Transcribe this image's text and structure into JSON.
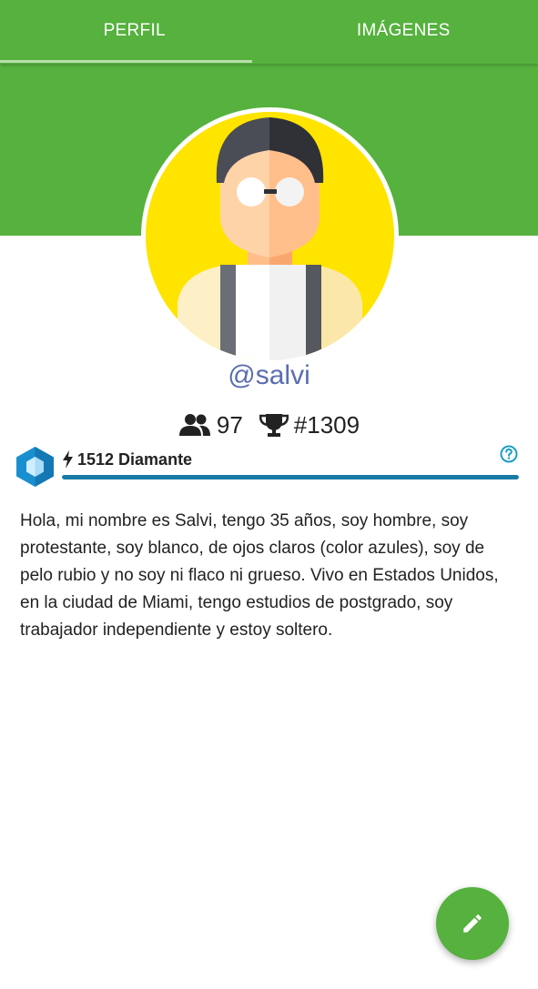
{
  "tabs": [
    {
      "label": "PERFIL",
      "selected": true
    },
    {
      "label": "IMÁGENES",
      "selected": false
    }
  ],
  "profile": {
    "username": "@salvi",
    "friends_icon": "people-icon",
    "friends_count": "97",
    "rank_icon": "trophy-icon",
    "rank": "#1309"
  },
  "level": {
    "badge_icon": "hexagon-badge-icon",
    "bolt_icon": "lightning-bolt-icon",
    "label": "1512 Diamante",
    "progress_percent": 100,
    "help_icon": "question-circle-icon"
  },
  "bio": "Hola, mi nombre es Salvi, tengo 35 años, soy hombre, soy protestante, soy blanco, de ojos claros (color azules), soy de pelo rubio y no soy ni flaco ni grueso. Vivo en Estados Unidos, en la ciudad de Miami, tengo estudios de postgrado, soy trabajador independiente y estoy soltero.",
  "fab": {
    "icon": "pencil-edit-icon"
  },
  "colors": {
    "primary": "#56b13e",
    "username": "#5b6db0",
    "progress": "#1a7aa6",
    "avatar_bg": "#ffe400"
  }
}
